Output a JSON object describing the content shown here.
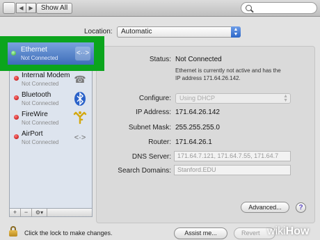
{
  "toolbar": {
    "back_icon": "back-arrow",
    "forward_icon": "forward-arrow",
    "show_all_label": "Show All",
    "search_icon": "magnifier"
  },
  "location": {
    "label": "Location:",
    "value": "Automatic"
  },
  "services": [
    {
      "name": "Ethernet",
      "status": "Not Connected",
      "icon": "ethernet-arrows",
      "selected": true,
      "status_color": "#2d9e2d"
    },
    {
      "name": "Internal Modem",
      "status": "Not Connected",
      "icon": "phone-handset",
      "selected": false,
      "status_color": "#c00000"
    },
    {
      "name": "Bluetooth",
      "status": "Not Connected",
      "icon": "bluetooth",
      "selected": false,
      "status_color": "#c00000"
    },
    {
      "name": "FireWire",
      "status": "Not Connected",
      "icon": "firewire",
      "selected": false,
      "status_color": "#c00000"
    },
    {
      "name": "AirPort",
      "status": "Not Connected",
      "icon": "airport-arrows",
      "selected": false,
      "status_color": "#c00000"
    }
  ],
  "sidebar_controls": {
    "add": "+",
    "remove": "−",
    "gear": "⚙▾"
  },
  "details": {
    "status_label": "Status:",
    "status_value": "Not Connected",
    "status_note": "Ethernet is currently not active and has the IP address 171.64.26.142.",
    "configure_label": "Configure:",
    "configure_value": "Using DHCP",
    "ip_label": "IP Address:",
    "ip_value": "171.64.26.142",
    "subnet_label": "Subnet Mask:",
    "subnet_value": "255.255.255.0",
    "router_label": "Router:",
    "router_value": "171.64.26.1",
    "dns_label": "DNS Server:",
    "dns_value": "171.64.7.121, 171.64.7.55, 171.64.7",
    "search_domains_label": "Search Domains:",
    "search_domains_value": "Stanford.EDU"
  },
  "buttons": {
    "advanced": "Advanced...",
    "help": "?",
    "assist": "Assist me...",
    "revert": "Revert"
  },
  "lock_text": "Click the lock to make changes.",
  "watermark": {
    "part1": "wiki",
    "part2": "How"
  },
  "colors": {
    "highlight": "#0ba51d",
    "selection": "#3d6db9",
    "error_dot": "#c00000"
  }
}
